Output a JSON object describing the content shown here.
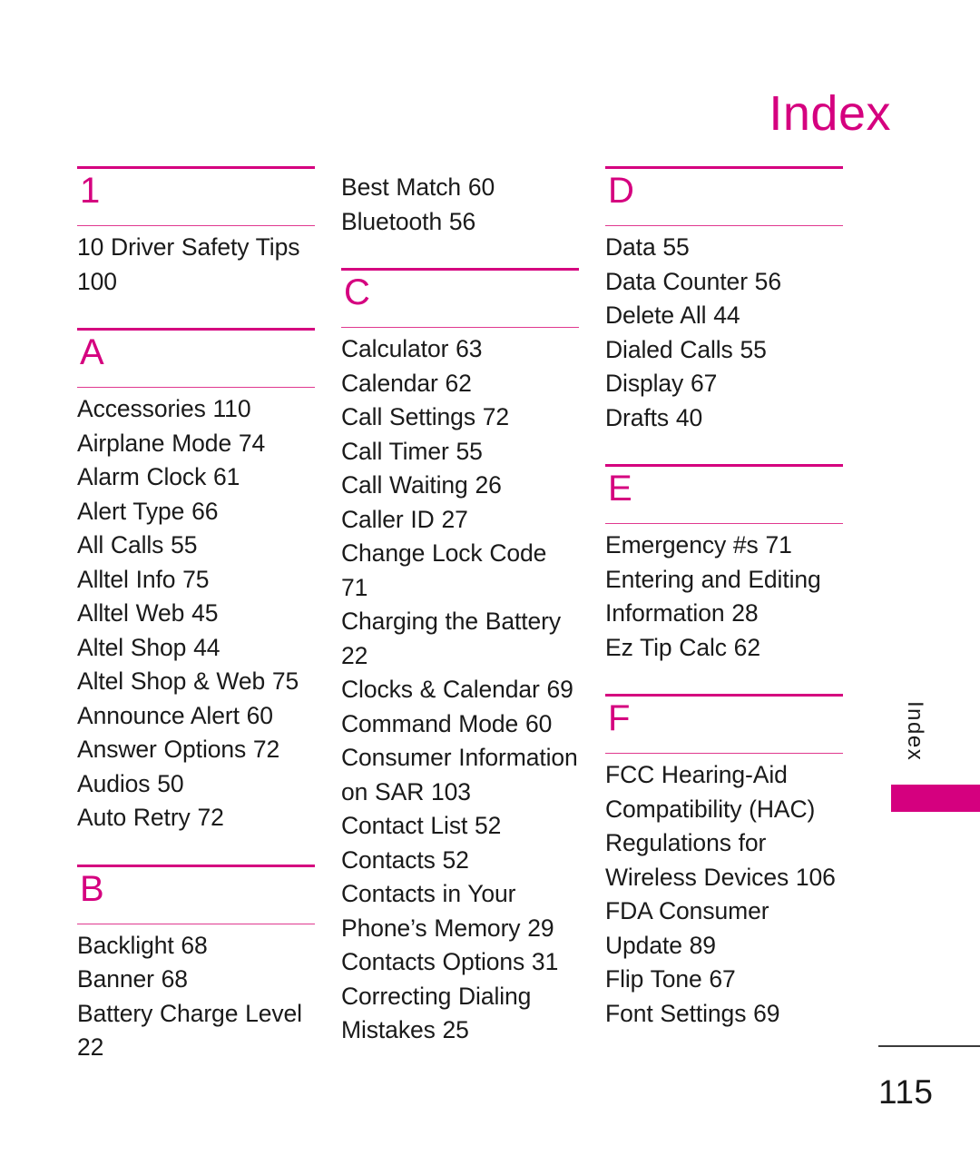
{
  "page": {
    "title": "Index",
    "folio": "115",
    "side_tab_label": "Index",
    "accent_color": "#d5007f",
    "text_color": "#1a1a1a"
  },
  "columns": [
    {
      "sections": [
        {
          "letter": "1",
          "continued": false,
          "entries": [
            "10 Driver Safety Tips 100"
          ]
        },
        {
          "letter": "A",
          "continued": false,
          "entries": [
            "Accessories 110",
            "Airplane Mode 74",
            "Alarm Clock 61",
            "Alert Type 66",
            "All Calls 55",
            "Alltel Info 75",
            "Alltel Web 45",
            "Altel Shop 44",
            "Altel Shop & Web 75",
            "Announce Alert 60",
            "Answer Options 72",
            "Audios 50",
            "Auto Retry 72"
          ]
        },
        {
          "letter": "B",
          "continued": false,
          "entries": [
            "Backlight 68",
            "Banner 68",
            "Battery Charge Level 22"
          ]
        }
      ]
    },
    {
      "sections": [
        {
          "letter": "",
          "continued": true,
          "entries": [
            "Best Match 60",
            "Bluetooth 56"
          ]
        },
        {
          "letter": "C",
          "continued": false,
          "entries": [
            "Calculator 63",
            "Calendar 62",
            "Call Settings 72",
            "Call Timer 55",
            "Call Waiting 26",
            "Caller ID 27",
            "Change Lock Code 71",
            "Charging the Battery 22",
            "Clocks & Calendar 69",
            "Command Mode 60",
            "Consumer Information on SAR 103",
            "Contact List 52",
            "Contacts 52",
            "Contacts in Your Phone’s Memory 29",
            "Contacts Options 31",
            "Correcting Dialing Mistakes 25"
          ]
        }
      ]
    },
    {
      "sections": [
        {
          "letter": "D",
          "continued": false,
          "entries": [
            "Data 55",
            "Data Counter 56",
            "Delete All 44",
            "Dialed Calls 55",
            "Display 67",
            "Drafts 40"
          ]
        },
        {
          "letter": "E",
          "continued": false,
          "entries": [
            "Emergency #s 71",
            "Entering and Editing Information 28",
            "Ez Tip Calc 62"
          ]
        },
        {
          "letter": "F",
          "continued": false,
          "entries": [
            "FCC Hearing-Aid Compatibility (HAC) Regulations for Wireless Devices 106",
            "FDA Consumer Update 89",
            "Flip Tone 67",
            "Font Settings 69"
          ]
        }
      ]
    }
  ]
}
